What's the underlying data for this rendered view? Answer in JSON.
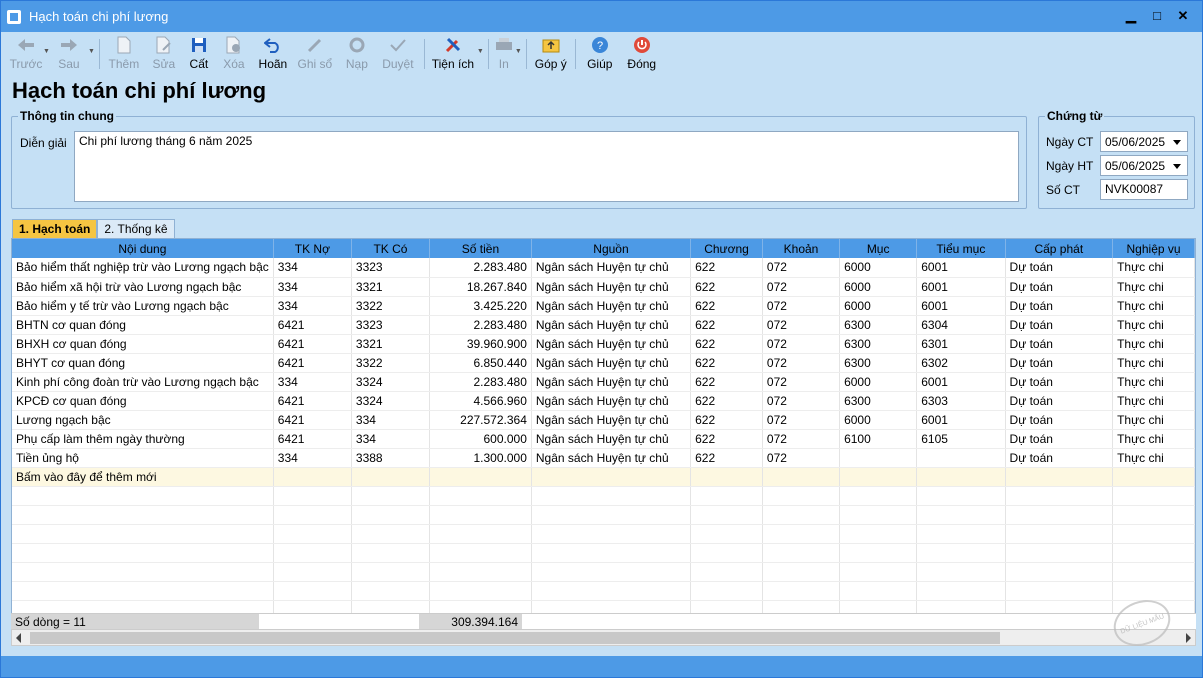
{
  "window": {
    "title": "Hạch toán chi phí lương",
    "minimize": "▁",
    "maximize": "□",
    "close": "✕"
  },
  "toolbar": {
    "buttons": [
      {
        "label": "Trước",
        "icon": "arrow-left-icon",
        "enabled": false
      },
      {
        "label": "Sau",
        "icon": "arrow-right-icon",
        "enabled": false
      },
      {
        "label": "Thêm",
        "icon": "new-document-icon",
        "enabled": false
      },
      {
        "label": "Sửa",
        "icon": "edit-document-icon",
        "enabled": false
      },
      {
        "label": "Cất",
        "icon": "save-icon",
        "enabled": true
      },
      {
        "label": "Xóa",
        "icon": "delete-document-icon",
        "enabled": false
      },
      {
        "label": "Hoãn",
        "icon": "undo-icon",
        "enabled": true
      },
      {
        "label": "Ghi sổ",
        "icon": "pencil-icon",
        "enabled": false
      },
      {
        "label": "Nạp",
        "icon": "refresh-icon",
        "enabled": false
      },
      {
        "label": "Duyệt",
        "icon": "checkmark-icon",
        "enabled": false
      },
      {
        "label": "Tiện ích",
        "icon": "tools-icon",
        "enabled": true
      },
      {
        "label": "In",
        "icon": "printer-icon",
        "enabled": false
      },
      {
        "label": "Góp ý",
        "icon": "feedback-icon",
        "enabled": true
      },
      {
        "label": "Giúp",
        "icon": "help-icon",
        "enabled": true
      },
      {
        "label": "Đóng",
        "icon": "power-icon",
        "enabled": true
      }
    ]
  },
  "page": {
    "title": "Hạch toán chi phí lương"
  },
  "general": {
    "legend": "Thông tin chung",
    "desc_label": "Diễn giải",
    "desc_value": "Chi phí lương tháng 6 năm 2025"
  },
  "voucher": {
    "legend": "Chứng từ",
    "date_ct_label": "Ngày CT",
    "date_ct": "05/06/2025",
    "date_ht_label": "Ngày HT",
    "date_ht": "05/06/2025",
    "no_label": "Số CT",
    "no_value": "NVK00087"
  },
  "tabs": [
    {
      "label": "1. Hạch toán",
      "active": true
    },
    {
      "label": "2. Thống kê",
      "active": false
    }
  ],
  "grid": {
    "columns": [
      "Nội dung",
      "TK Nợ",
      "TK Có",
      "Số tiền",
      "Nguồn",
      "Chương",
      "Khoản",
      "Mục",
      "Tiểu mục",
      "Cấp phát",
      "Nghiệp vụ"
    ],
    "rows": [
      [
        "Bảo hiểm thất nghiệp trừ vào Lương ngạch bậc",
        "334",
        "3323",
        "2.283.480",
        "Ngân sách Huyện tự chủ",
        "622",
        "072",
        "6000",
        "6001",
        "Dự toán",
        "Thực chi"
      ],
      [
        "Bảo hiểm xã hội trừ vào Lương ngạch bậc",
        "334",
        "3321",
        "18.267.840",
        "Ngân sách Huyện tự chủ",
        "622",
        "072",
        "6000",
        "6001",
        "Dự toán",
        "Thực chi"
      ],
      [
        "Bảo hiểm y tế trừ vào Lương ngạch bậc",
        "334",
        "3322",
        "3.425.220",
        "Ngân sách Huyện tự chủ",
        "622",
        "072",
        "6000",
        "6001",
        "Dự toán",
        "Thực chi"
      ],
      [
        "BHTN cơ quan đóng",
        "6421",
        "3323",
        "2.283.480",
        "Ngân sách Huyện tự chủ",
        "622",
        "072",
        "6300",
        "6304",
        "Dự toán",
        "Thực chi"
      ],
      [
        "BHXH cơ quan đóng",
        "6421",
        "3321",
        "39.960.900",
        "Ngân sách Huyện tự chủ",
        "622",
        "072",
        "6300",
        "6301",
        "Dự toán",
        "Thực chi"
      ],
      [
        "BHYT cơ quan đóng",
        "6421",
        "3322",
        "6.850.440",
        "Ngân sách Huyện tự chủ",
        "622",
        "072",
        "6300",
        "6302",
        "Dự toán",
        "Thực chi"
      ],
      [
        "Kinh phí công đoàn trừ vào Lương ngạch bậc",
        "334",
        "3324",
        "2.283.480",
        "Ngân sách Huyện tự chủ",
        "622",
        "072",
        "6000",
        "6001",
        "Dự toán",
        "Thực chi"
      ],
      [
        "KPCĐ cơ quan đóng",
        "6421",
        "3324",
        "4.566.960",
        "Ngân sách Huyện tự chủ",
        "622",
        "072",
        "6300",
        "6303",
        "Dự toán",
        "Thực chi"
      ],
      [
        "Lương ngạch bậc",
        "6421",
        "334",
        "227.572.364",
        "Ngân sách Huyện tự chủ",
        "622",
        "072",
        "6000",
        "6001",
        "Dự toán",
        "Thực chi"
      ],
      [
        "Phụ cấp làm thêm ngày thường",
        "6421",
        "334",
        "600.000",
        "Ngân sách Huyện tự chủ",
        "622",
        "072",
        "6100",
        "6105",
        "Dự toán",
        "Thực chi"
      ],
      [
        "Tiền ủng hộ",
        "334",
        "3388",
        "1.300.000",
        "Ngân sách Huyện tự chủ",
        "622",
        "072",
        "",
        "",
        "Dự toán",
        "Thực chi"
      ]
    ],
    "new_row_hint": "Bấm vào đây để thêm mới",
    "row_count": "Số dòng = 11",
    "total": "309.394.164"
  },
  "stamp": "DỮ LIỆU MẪU",
  "colors": {
    "titlebar": "#4d9ae6",
    "background": "#c5e0f5",
    "active_tab": "#f5c542"
  }
}
